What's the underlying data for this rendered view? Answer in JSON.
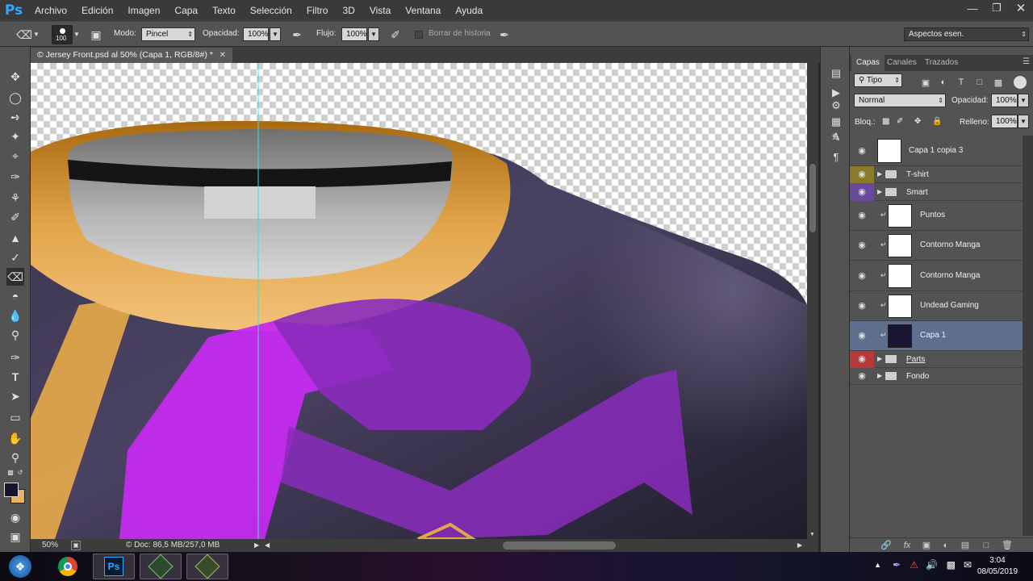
{
  "app": {
    "logo": "Ps",
    "menu": [
      "Archivo",
      "Edición",
      "Imagen",
      "Capa",
      "Texto",
      "Selección",
      "Filtro",
      "3D",
      "Vista",
      "Ventana",
      "Ayuda"
    ],
    "window_controls": [
      "minimize-icon",
      "restore-icon",
      "close-icon"
    ]
  },
  "options": {
    "brush_size": "100",
    "mode_label": "Modo:",
    "mode_value": "Pincel",
    "opacity_label": "Opacidad:",
    "opacity_value": "100%",
    "flow_label": "Flujo:",
    "flow_value": "100%",
    "history_label": "Borrar de historia",
    "workspace": "Aspectos esen."
  },
  "document": {
    "tab_title": "© Jersey Front.psd al 50% (Capa 1, RGB/8#) *"
  },
  "status": {
    "zoom": "50%",
    "doc_size": "© Doc: 86,5 MB/257,0 MB"
  },
  "layers_panel": {
    "tabs": [
      "Capas",
      "Canales",
      "Trazados"
    ],
    "filter_value": "Tipo",
    "blend_mode": "Normal",
    "opacity_label": "Opacidad:",
    "opacity_value": "100%",
    "lock_label": "Bloq.:",
    "fill_label": "Relleno:",
    "fill_value": "100%",
    "layers": [
      {
        "name": "Capa 1 copia 3",
        "type": "layer"
      },
      {
        "name": "T-shirt",
        "type": "group",
        "color": "#8a7a2a"
      },
      {
        "name": "Smart",
        "type": "group",
        "color": "#6a4a9a"
      },
      {
        "name": "Puntos",
        "type": "clipped"
      },
      {
        "name": "Contorno Manga",
        "type": "clipped"
      },
      {
        "name": "Contorno Manga",
        "type": "clipped"
      },
      {
        "name": "Undead Gaming",
        "type": "clipped"
      },
      {
        "name": "Capa 1",
        "type": "clipped",
        "selected": true
      },
      {
        "name": "Parts",
        "type": "group",
        "color": "#b8383a"
      },
      {
        "name": "Fondo",
        "type": "group"
      }
    ]
  },
  "taskbar": {
    "time": "3:04",
    "date": "08/05/2019"
  },
  "colors": {
    "accent": "#31a8ff",
    "selection": "#5d6f8c",
    "collar": "#e2a54a",
    "shirt": "#3a3450",
    "logo": "#b62ae0"
  }
}
